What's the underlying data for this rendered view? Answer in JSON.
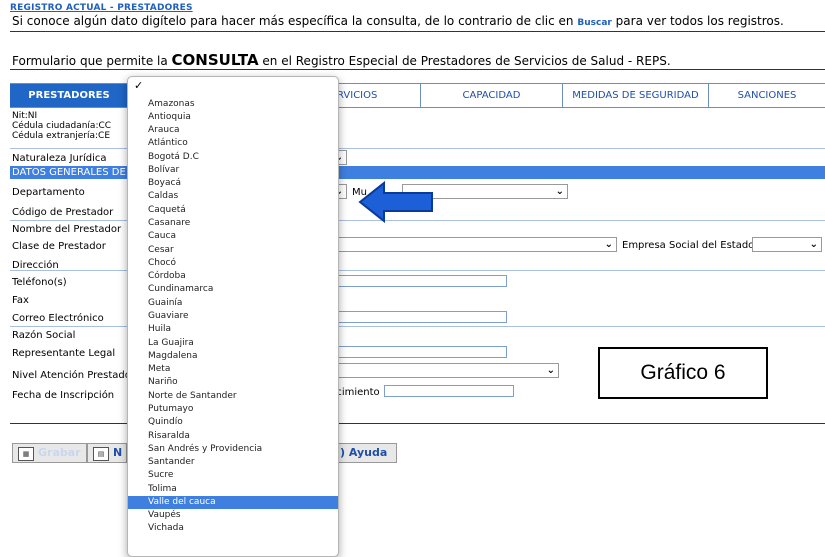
{
  "header": {
    "title": "REGISTRO ACTUAL - PRESTADORES",
    "instruction_before": "Si conoce algún dato digítelo para hacer más específica la consulta, de lo contrario de clic en",
    "instruction_link": "Buscar",
    "instruction_after": "para ver todos los registros.",
    "form_prefix": "Formulario que permite la",
    "form_bold": "CONSULTA",
    "form_suffix": "en el Registro Especial de Prestadores de Servicios de Salud - REPS."
  },
  "tabs": [
    "PRESTADORES",
    "RVICIOS",
    "CAPACIDAD",
    "MEDIDAS DE SEGURIDAD",
    "SANCIONES"
  ],
  "id_types": [
    "Nit:NI",
    "Cédula ciudadanía:CC",
    "Cédula extranjería:CE"
  ],
  "section_title": "DATOS GENERALES DE",
  "labels": {
    "naturaleza": "Naturaleza Jurídica",
    "departamento": "Departamento",
    "codigo": "Código de Prestador",
    "nombre": "Nombre del Prestador",
    "clase": "Clase de Prestador",
    "direccion": "Dirección",
    "telefonos": "Teléfono(s)",
    "fax": "Fax",
    "correo": "Correo Electrónico",
    "razon": "Razón Social",
    "representante": "Representante Legal",
    "nivel": "Nivel Atención Prestado",
    "fecha": "Fecha de Inscripción",
    "municipio_partial": "Mu",
    "empresa_social": "Empresa Social del Estado",
    "vencimiento_partial": "ncimiento"
  },
  "buttons": {
    "grabar": "Grabar",
    "nuevo_partial": "N",
    "ayuda_partial": ") Ayuda"
  },
  "annotation": "Gráfico 6",
  "dropdown": {
    "checked_value": "",
    "options": [
      "Amazonas",
      "Antioquia",
      "Arauca",
      "Atlántico",
      "Bogotá D.C",
      "Bolívar",
      "Boyacá",
      "Caldas",
      "Caquetá",
      "Casanare",
      "Cauca",
      "Cesar",
      "Chocó",
      "Córdoba",
      "Cundinamarca",
      "Guainía",
      "Guaviare",
      "Huila",
      "La Guajira",
      "Magdalena",
      "Meta",
      "Nariño",
      "Norte de Santander",
      "Putumayo",
      "Quindío",
      "Risaralda",
      "San Andrés y Providencia",
      "Santander",
      "Sucre",
      "Tolima",
      "Valle del cauca",
      "Vaupés",
      "Vichada"
    ],
    "highlighted": "Valle del cauca"
  },
  "colors": {
    "accent": "#1f66c6",
    "highlight": "#3f7fe0",
    "arrow": "#1d5fd6"
  }
}
